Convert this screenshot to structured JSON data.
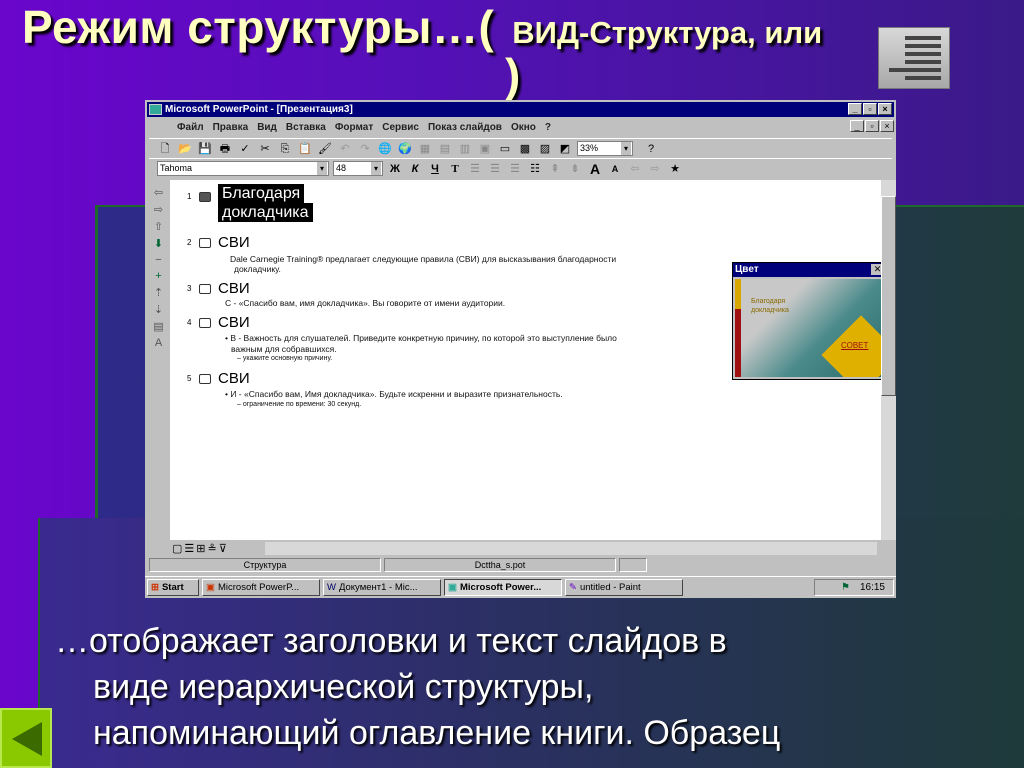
{
  "slide": {
    "title_main": "Режим структуры…(",
    "title_sub": "ВИД-Структура, или",
    "title_close": ")",
    "body_lines": [
      "…отображает заголовки и текст слайдов в",
      "виде иерархической структуры,",
      "напоминающий оглавление книги. Образец"
    ],
    "back_button_icon": "triangle-left-icon",
    "outline_view_icon": "outline-view-icon"
  },
  "window": {
    "title": "Microsoft PowerPoint - [Презентация3]",
    "menu": [
      "Файл",
      "Правка",
      "Вид",
      "Вставка",
      "Формат",
      "Сервис",
      "Показ слайдов",
      "Окно",
      "?"
    ],
    "zoom": "33%",
    "font": "Tahoma",
    "font_size": "48",
    "format_buttons": [
      "Ж",
      "К",
      "Ч",
      "Т"
    ],
    "slides": [
      {
        "num": "1",
        "title_line1": "Благодаря",
        "title_line2": "докладчика"
      },
      {
        "num": "2",
        "title": "СВИ",
        "body": "Dale Carnegie Training® предлагает следующие правила (СВИ) для высказывания благодарности",
        "body2": "докладчику."
      },
      {
        "num": "3",
        "title": "СВИ",
        "body": "С - «Спасибо вам, имя докладчика».  Вы говорите от имени аудитории."
      },
      {
        "num": "4",
        "title": "СВИ",
        "body": "• В - Важность для слушателей.  Приведите конкретную причину, по которой это выступление было",
        "body2": "важным для собравшихся.",
        "sub": "– укажите основную причину."
      },
      {
        "num": "5",
        "title": "СВИ",
        "body": "• И - «Спасибо вам, Имя докладчика».  Будьте искренни и выразите признательность.",
        "sub": "– ограничение по времени: 30 секунд."
      }
    ],
    "palette": {
      "title": "Цвет",
      "preview_title": "Благодаря докладчика",
      "preview_badge": "СОВЕТ"
    },
    "status": {
      "view": "Структура",
      "template": "Dcttha_s.pot"
    },
    "taskbar": {
      "start": "Start",
      "items": [
        "Microsoft PowerP...",
        "Документ1 - Mic...",
        "Microsoft Power...",
        "untitled - Paint"
      ],
      "clock": "16:15"
    }
  }
}
